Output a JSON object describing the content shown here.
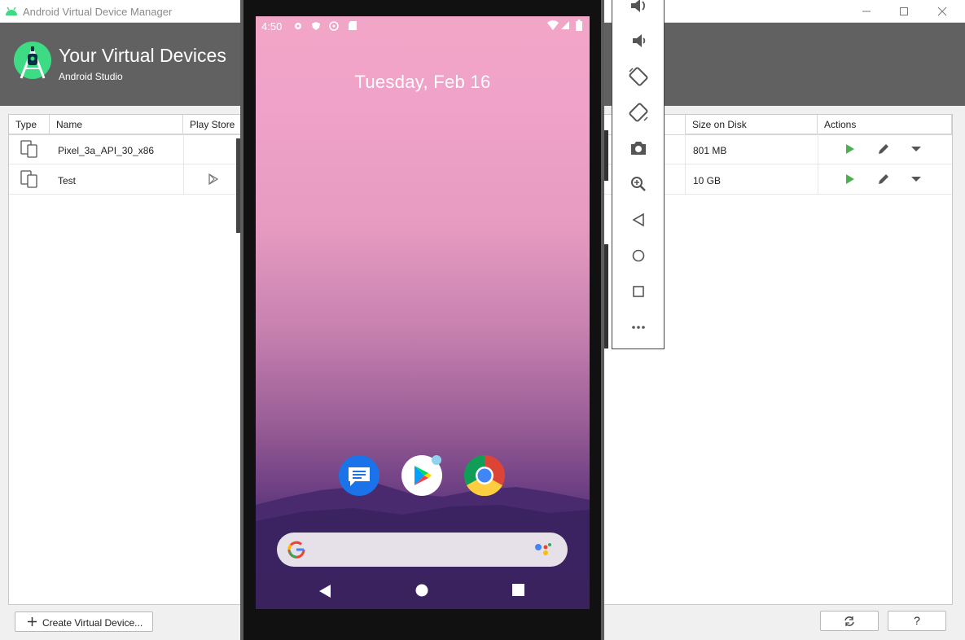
{
  "window": {
    "title": "Android Virtual Device Manager",
    "min_icon": "minimize-icon",
    "max_icon": "maximize-icon",
    "close_icon": "close-icon"
  },
  "header": {
    "title": "Your Virtual Devices",
    "subtitle": "Android Studio"
  },
  "table": {
    "columns": [
      "Type",
      "Name",
      "Play Store",
      "Size on Disk",
      "Actions"
    ],
    "rows": [
      {
        "name": "Pixel_3a_API_30_x86",
        "play_store": false,
        "size": "801 MB"
      },
      {
        "name": "Test",
        "play_store": true,
        "size": "10 GB"
      }
    ]
  },
  "buttons": {
    "create": "Create Virtual Device...",
    "help": "?"
  },
  "emulator": {
    "status_time": "4:50",
    "date": "Tuesday, Feb 16",
    "apps": [
      "Messages",
      "Play Store",
      "Chrome"
    ],
    "toolbar": [
      "volume-up-icon",
      "volume-down-icon",
      "rotate-left-icon",
      "rotate-right-icon",
      "camera-icon",
      "zoom-icon",
      "back-icon",
      "home-icon",
      "overview-icon",
      "more-icon"
    ]
  },
  "colors": {
    "header_bg": "#616161",
    "accent_green": "#3ddc84",
    "play_green": "#4caf50"
  }
}
